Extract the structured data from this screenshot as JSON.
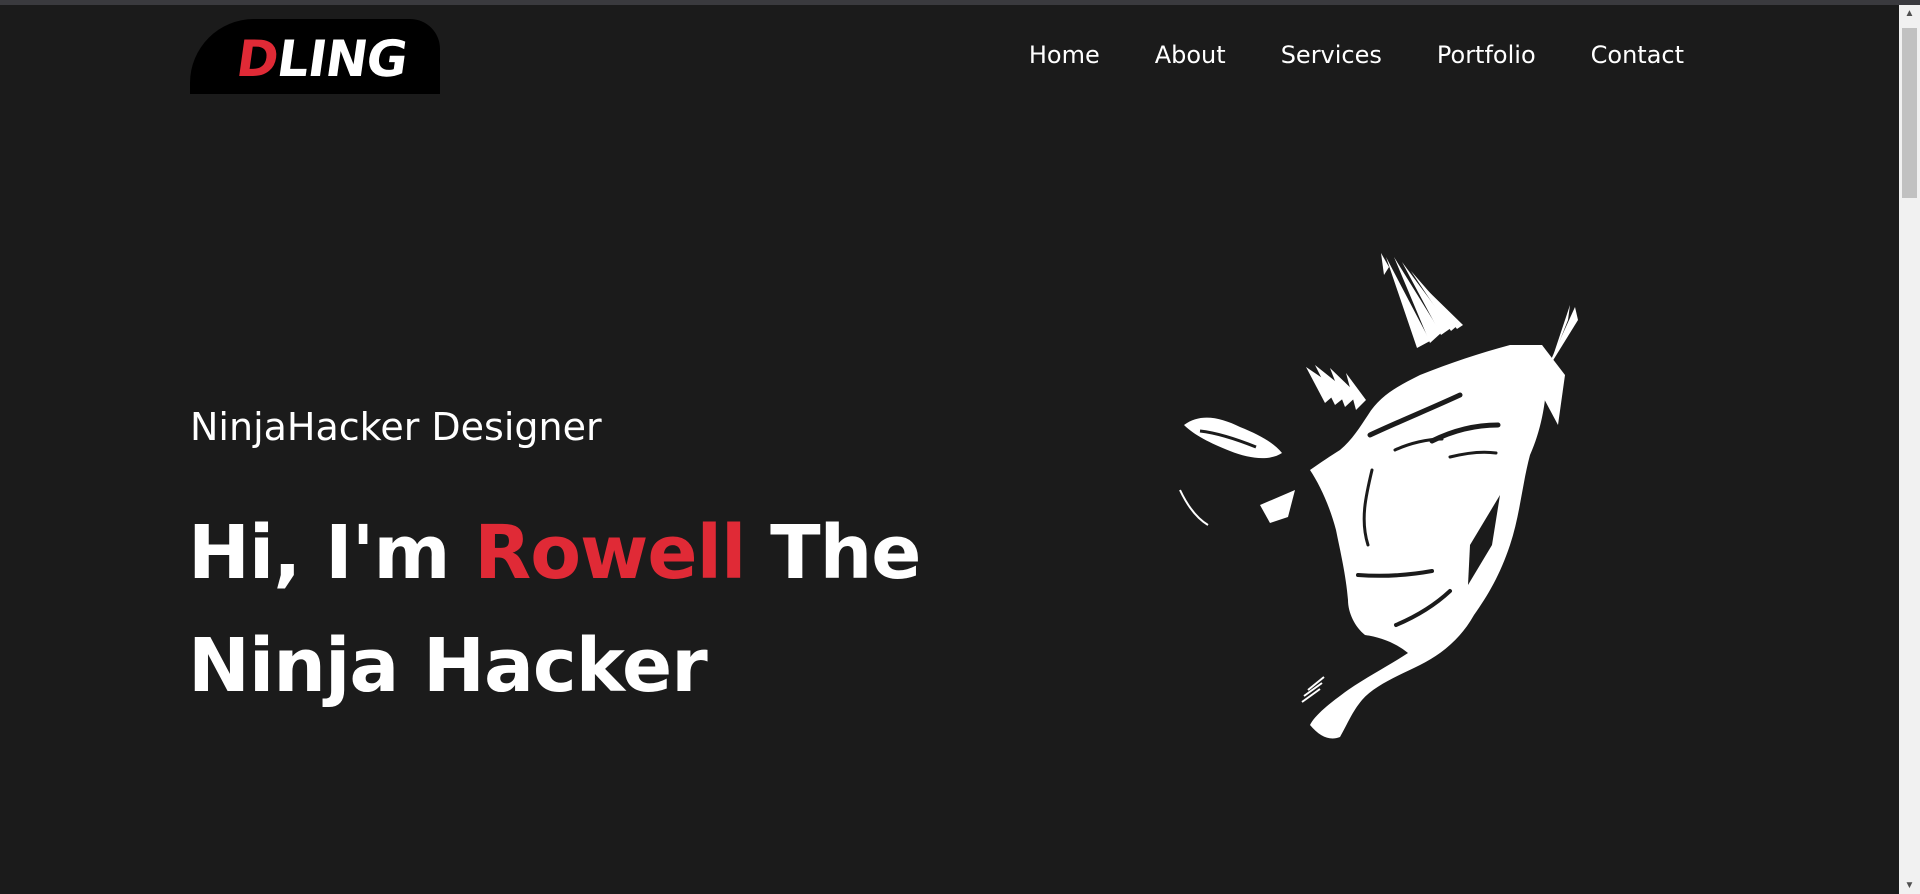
{
  "logo": {
    "first_letter": "D",
    "rest": "LING"
  },
  "nav": {
    "items": [
      "Home",
      "About",
      "Services",
      "Portfolio",
      "Contact"
    ]
  },
  "hero": {
    "subtitle": "NinjaHacker Designer",
    "headline_prefix": "Hi, I'm ",
    "headline_name": "Rowell",
    "headline_suffix": " The Ninja Hacker"
  },
  "illustration": {
    "icon": "ninja-face-icon"
  },
  "colors": {
    "background": "#1b1b1b",
    "accent": "#e02a36",
    "text": "#ffffff",
    "logo_bg": "#000000"
  },
  "scrollbar": {
    "up_icon": "chevron-up-icon",
    "down_icon": "chevron-down-icon"
  }
}
